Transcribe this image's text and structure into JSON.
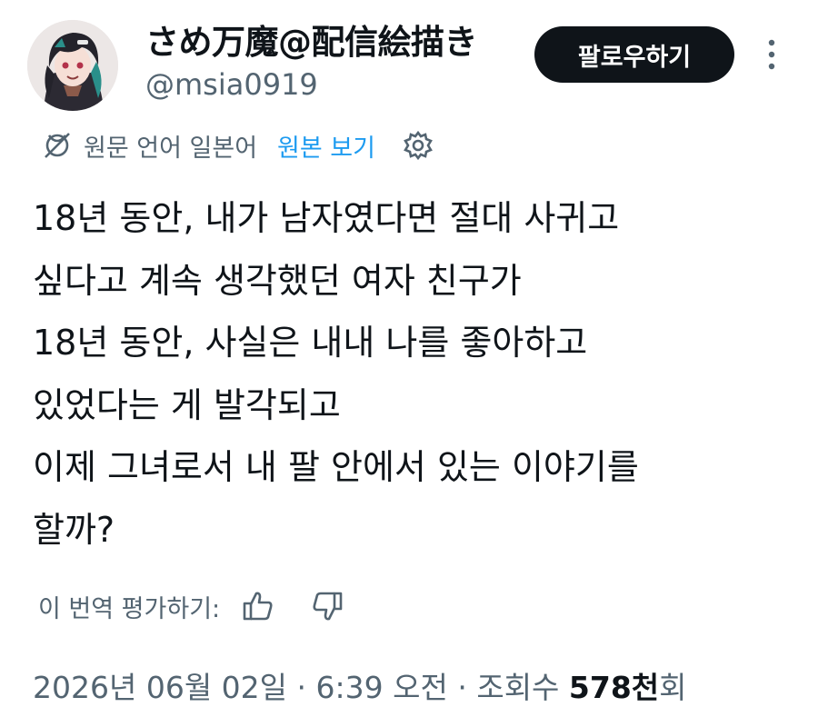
{
  "author": {
    "display_name": "さめ万魔@配信絵描き",
    "handle": "@msia0919",
    "avatar_icon": "avatar-illustration"
  },
  "follow_button_label": "팔로우하기",
  "more_icon": "more-vertical-icon",
  "translation": {
    "icon": "translate-globe-icon",
    "note": "원문 언어 일본어",
    "show_original_label": "원본 보기",
    "settings_icon": "gear-icon"
  },
  "tweet_lines": [
    "18년 동안, 내가 남자였다면 절대 사귀고",
    "싶다고 계속 생각했던 여자 친구가",
    "18년 동안, 사실은 내내 나를 좋아하고",
    "있었다는 게 발각되고",
    "이제 그녀로서 내 팔 안에서 있는 이야기를",
    "할까?"
  ],
  "rating": {
    "label": "이 번역 평가하기:",
    "up_icon": "thumbs-up-icon",
    "down_icon": "thumbs-down-icon"
  },
  "meta": {
    "date": "2026년 06월 02일",
    "separator1": " · ",
    "time": "6:39 오전",
    "separator2": " · ",
    "views_label": "조회수 ",
    "views_count": "578천",
    "views_suffix": "회"
  },
  "colors": {
    "text": "#0f1419",
    "secondary": "#536471",
    "link": "#1d9bf0",
    "button_bg": "#0f1419"
  }
}
